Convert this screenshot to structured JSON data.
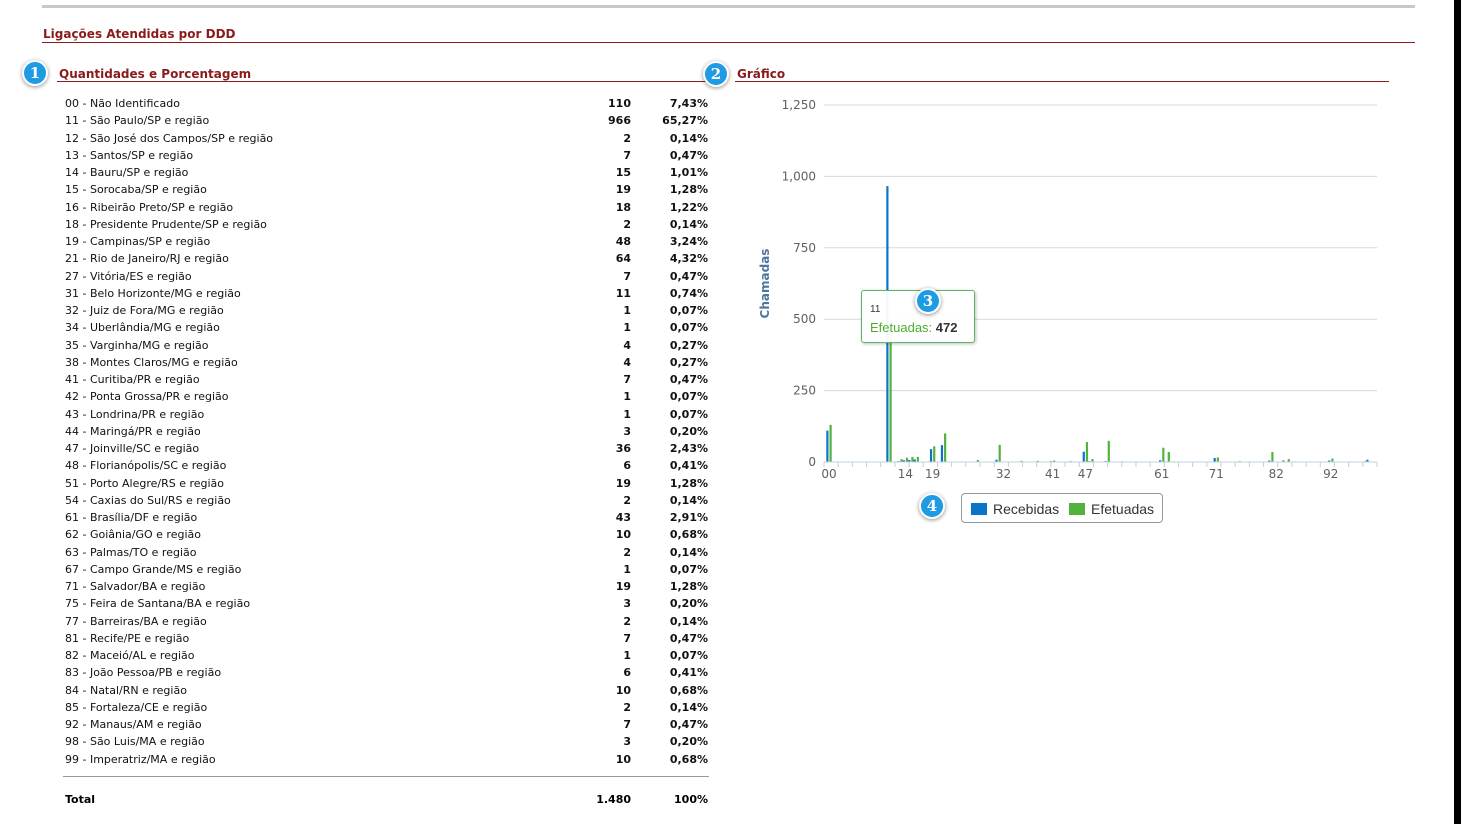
{
  "page": {
    "title": "Ligações Atendidas por DDD"
  },
  "markers": [
    "1",
    "2",
    "3",
    "4"
  ],
  "left": {
    "title": "Quantidades e Porcentagem"
  },
  "right": {
    "title": "Gráfico"
  },
  "table": {
    "rows": [
      {
        "name": "00 - Não Identificado",
        "qty": "110",
        "pct": "7,43%"
      },
      {
        "name": "11 - São Paulo/SP e região",
        "qty": "966",
        "pct": "65,27%"
      },
      {
        "name": "12 - São José dos Campos/SP e região",
        "qty": "2",
        "pct": "0,14%"
      },
      {
        "name": "13 - Santos/SP e região",
        "qty": "7",
        "pct": "0,47%"
      },
      {
        "name": "14 - Bauru/SP e região",
        "qty": "15",
        "pct": "1,01%"
      },
      {
        "name": "15 - Sorocaba/SP e região",
        "qty": "19",
        "pct": "1,28%"
      },
      {
        "name": "16 - Ribeirão Preto/SP e região",
        "qty": "18",
        "pct": "1,22%"
      },
      {
        "name": "18 - Presidente Prudente/SP e região",
        "qty": "2",
        "pct": "0,14%"
      },
      {
        "name": "19 - Campinas/SP e região",
        "qty": "48",
        "pct": "3,24%"
      },
      {
        "name": "21 - Rio de Janeiro/RJ e região",
        "qty": "64",
        "pct": "4,32%"
      },
      {
        "name": "27 - Vitória/ES e região",
        "qty": "7",
        "pct": "0,47%"
      },
      {
        "name": "31 - Belo Horizonte/MG e região",
        "qty": "11",
        "pct": "0,74%"
      },
      {
        "name": "32 - Juiz de Fora/MG e região",
        "qty": "1",
        "pct": "0,07%"
      },
      {
        "name": "34 - Uberlândia/MG e região",
        "qty": "1",
        "pct": "0,07%"
      },
      {
        "name": "35 - Varginha/MG e região",
        "qty": "4",
        "pct": "0,27%"
      },
      {
        "name": "38 - Montes Claros/MG e região",
        "qty": "4",
        "pct": "0,27%"
      },
      {
        "name": "41 - Curitiba/PR e região",
        "qty": "7",
        "pct": "0,47%"
      },
      {
        "name": "42 - Ponta Grossa/PR e região",
        "qty": "1",
        "pct": "0,07%"
      },
      {
        "name": "43 - Londrina/PR e região",
        "qty": "1",
        "pct": "0,07%"
      },
      {
        "name": "44 - Maringá/PR e região",
        "qty": "3",
        "pct": "0,20%"
      },
      {
        "name": "47 - Joinville/SC e região",
        "qty": "36",
        "pct": "2,43%"
      },
      {
        "name": "48 - Florianópolis/SC e região",
        "qty": "6",
        "pct": "0,41%"
      },
      {
        "name": "51 - Porto Alegre/RS e região",
        "qty": "19",
        "pct": "1,28%"
      },
      {
        "name": "54 - Caxias do Sul/RS e região",
        "qty": "2",
        "pct": "0,14%"
      },
      {
        "name": "61 - Brasília/DF e região",
        "qty": "43",
        "pct": "2,91%"
      },
      {
        "name": "62 - Goiânia/GO e região",
        "qty": "10",
        "pct": "0,68%"
      },
      {
        "name": "63 - Palmas/TO e região",
        "qty": "2",
        "pct": "0,14%"
      },
      {
        "name": "67 - Campo Grande/MS e região",
        "qty": "1",
        "pct": "0,07%"
      },
      {
        "name": "71 - Salvador/BA e região",
        "qty": "19",
        "pct": "1,28%"
      },
      {
        "name": "75 - Feira de Santana/BA e região",
        "qty": "3",
        "pct": "0,20%"
      },
      {
        "name": "77 - Barreiras/BA e região",
        "qty": "2",
        "pct": "0,14%"
      },
      {
        "name": "81 - Recife/PE e região",
        "qty": "7",
        "pct": "0,47%"
      },
      {
        "name": "82 - Maceió/AL e região",
        "qty": "1",
        "pct": "0,07%"
      },
      {
        "name": "83 - João Pessoa/PB e região",
        "qty": "6",
        "pct": "0,41%"
      },
      {
        "name": "84 - Natal/RN e região",
        "qty": "10",
        "pct": "0,68%"
      },
      {
        "name": "85 - Fortaleza/CE e região",
        "qty": "2",
        "pct": "0,14%"
      },
      {
        "name": "92 - Manaus/AM e região",
        "qty": "7",
        "pct": "0,47%"
      },
      {
        "name": "98 - São Luis/MA e região",
        "qty": "3",
        "pct": "0,20%"
      },
      {
        "name": "99 - Imperatriz/MA e região",
        "qty": "10",
        "pct": "0,68%"
      }
    ],
    "total": {
      "label": "Total",
      "qty": "1.480",
      "pct": "100%"
    }
  },
  "chart_data": {
    "type": "bar",
    "title": "",
    "ylabel": "Chamadas",
    "xlabel": "",
    "ylim": [
      0,
      1250
    ],
    "yticks": [
      "0",
      "250",
      "500",
      "750",
      "1,000",
      "1,250"
    ],
    "xtick_labels": [
      "00",
      "14",
      "19",
      "32",
      "41",
      "47",
      "61",
      "71",
      "82",
      "92"
    ],
    "categories": [
      "00",
      "11",
      "12",
      "13",
      "14",
      "15",
      "16",
      "18",
      "19",
      "21",
      "27",
      "31",
      "32",
      "34",
      "35",
      "38",
      "41",
      "42",
      "43",
      "44",
      "47",
      "48",
      "51",
      "54",
      "61",
      "62",
      "63",
      "67",
      "71",
      "75",
      "77",
      "81",
      "82",
      "83",
      "84",
      "85",
      "92",
      "98",
      "99"
    ],
    "series": [
      {
        "name": "Recebidas",
        "color": "#0a75c7",
        "values": [
          110,
          966,
          0,
          3,
          6,
          7,
          9,
          0,
          45,
          59,
          0,
          8,
          0,
          0,
          0,
          0,
          3,
          0,
          0,
          0,
          36,
          3,
          3,
          2,
          6,
          2,
          0,
          0,
          14,
          0,
          0,
          5,
          0,
          0,
          0,
          0,
          5,
          0,
          8
        ]
      },
      {
        "name": "Efetuadas",
        "color": "#52b23e",
        "values": [
          130,
          472,
          2,
          10,
          15,
          18,
          18,
          2,
          55,
          100,
          7,
          60,
          1,
          1,
          4,
          4,
          5,
          1,
          1,
          3,
          70,
          10,
          74,
          2,
          50,
          35,
          2,
          1,
          16,
          3,
          2,
          35,
          1,
          6,
          10,
          2,
          12,
          3,
          2
        ]
      }
    ],
    "tooltip": {
      "category": "11",
      "series": "Efetuadas",
      "value": "472"
    },
    "legend_position": "bottom-center"
  }
}
